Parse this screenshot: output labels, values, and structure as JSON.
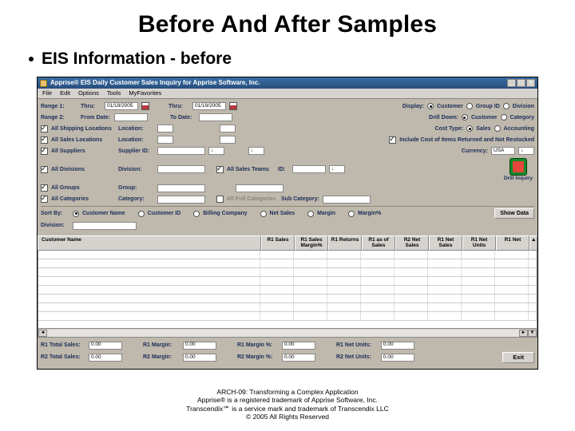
{
  "slide": {
    "title": "Before And After Samples",
    "bullet": "EIS Information  - before"
  },
  "window": {
    "title": "Apprise® EIS Daily Customer Sales Inquiry for Apprise Software, Inc.",
    "menu": [
      "File",
      "Edit",
      "Options",
      "Tools",
      "MyFavorites"
    ]
  },
  "form": {
    "range1_label": "Range 1:",
    "range1_from": "Thru:",
    "range1_date": "01/19/2005",
    "range1_to_label": "Thru:",
    "range1_to_date": "01/19/2005",
    "range2_label": "Range 2:",
    "range2_from_label": "From Date:",
    "range2_to_label": "To Date:",
    "display_label": "Display:",
    "display_opts": [
      "Customer",
      "Group ID",
      "Division"
    ],
    "drilldown_label": "Drill Down:",
    "drilldown_opts": [
      "Customer",
      "Category"
    ],
    "costtype_label": "Cost Type:",
    "costtype_opts": [
      "Sales",
      "Accounting"
    ],
    "include_label": "Include Cost of Items Returned and Not Restocked",
    "currency_label": "Currency:",
    "currency_value": "USA",
    "chk_allship": "All Shipping Locations",
    "lbl_location": "Location:",
    "chk_allsales_loc": "All Sales Locations",
    "lbl_location2": "Location:",
    "chk_allsupp": "All Suppliers",
    "lbl_suppid": "Supplier ID:",
    "chk_alldiv": "All Divisions",
    "lbl_division": "Division:",
    "chk_allsalesteams": "All Sales Teams",
    "lbl_salesid": "ID:",
    "chk_allgroups": "All Groups",
    "lbl_group": "Group:",
    "chk_allcat": "All Categories",
    "lbl_category": "Category:",
    "chk_allfull": "All Full Categories",
    "lbl_subcat": "Sub Category:",
    "green_caption": "Drill\nInquiry",
    "sortby_label": "Sort By:",
    "sort_opts": [
      "Customer Name",
      "Customer ID",
      "Billing Company",
      "Net Sales",
      "Margin",
      "Margin%"
    ],
    "division_label": "Division:",
    "show_button": "Show Data"
  },
  "grid": {
    "columns": [
      "Customer Name",
      "R1 Sales",
      "R1 Sales Margin%",
      "R1 Returns",
      "R1 as of Sales",
      "R2 Net Sales",
      "R1 Net Sales",
      "R1 Net Units",
      "R1 Net"
    ]
  },
  "totals": {
    "r1_total_sales_lbl": "R1 Total Sales:",
    "r1_total_sales": "0.00",
    "r1_margin_lbl": "R1 Margin:",
    "r1_margin": "0.00",
    "r1_marginpct_lbl": "R1 Margin %:",
    "r1_marginpct": "0.00",
    "r1_netunits_lbl": "R1 Net Units:",
    "r1_netunits": "0.00",
    "r2_total_sales_lbl": "R2 Total Sales:",
    "r2_total_sales": "0.00",
    "r2_margin_lbl": "R2 Margin:",
    "r2_margin": "0.00",
    "r2_marginpct_lbl": "R2 Margin %:",
    "r2_marginpct": "0.00",
    "r2_netunits_lbl": "R2 Net Units:",
    "r2_netunits": "0.00",
    "exit_button": "Exit"
  },
  "footnotes": {
    "l1": "ARCH-09:  Transforming a Complex Application",
    "l2": "Apprise® is a registered trademark of Apprise Software, Inc.",
    "l3": "Transcendix℠ is a service mark and trademark of Transcendix LLC",
    "l4": "© 2005 All Rights Reserved"
  }
}
